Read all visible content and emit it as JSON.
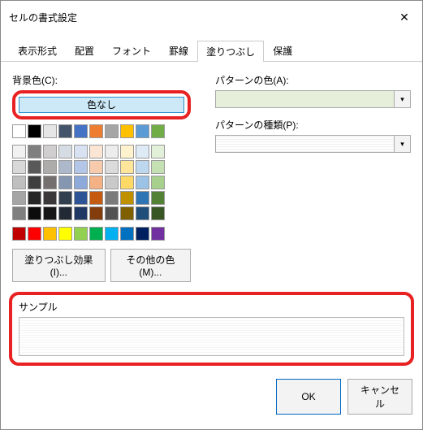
{
  "window": {
    "title": "セルの書式設定"
  },
  "tabs": [
    "表示形式",
    "配置",
    "フォント",
    "罫線",
    "塗りつぶし",
    "保護"
  ],
  "active_tab": "塗りつぶし",
  "labels": {
    "bgcolor": "背景色(C):",
    "no_color": "色なし",
    "pattern_color": "パターンの色(A):",
    "pattern_type": "パターンの種類(P):",
    "fill_effects": "塗りつぶし効果(I)...",
    "more_colors": "その他の色(M)...",
    "sample": "サンプル",
    "ok": "OK",
    "cancel": "キャンセル"
  },
  "swatches_row1": [
    "#ffffff",
    "#000000",
    "#e7e6e6",
    "#44546a",
    "#4472c4",
    "#ed7d31",
    "#a5a5a5",
    "#ffc000",
    "#5b9bd5",
    "#70ad47"
  ],
  "swatches_theme": [
    "#f2f2f2",
    "#7f7f7f",
    "#d0cece",
    "#d6dce4",
    "#d9e2f3",
    "#fbe5d5",
    "#ededed",
    "#fff2cc",
    "#deebf6",
    "#e2efd9",
    "#d8d8d8",
    "#595959",
    "#aeabab",
    "#adb9ca",
    "#b4c6e7",
    "#f7cbac",
    "#dbdbdb",
    "#fee599",
    "#bdd7ee",
    "#c5e0b3",
    "#bfbfbf",
    "#3f3f3f",
    "#757070",
    "#8496b0",
    "#8eaadb",
    "#f4b183",
    "#c9c9c9",
    "#ffd965",
    "#9cc3e5",
    "#a8d08d",
    "#a5a5a5",
    "#262626",
    "#3a3838",
    "#323f4f",
    "#2f5496",
    "#c55a11",
    "#7b7b7b",
    "#bf9000",
    "#2e75b5",
    "#538135",
    "#7f7f7f",
    "#0c0c0c",
    "#171616",
    "#222a35",
    "#1f3864",
    "#833c0b",
    "#525252",
    "#7f6000",
    "#1e4e79",
    "#375623"
  ],
  "swatches_standard": [
    "#c00000",
    "#ff0000",
    "#ffc000",
    "#ffff00",
    "#92d050",
    "#00b050",
    "#00b0f0",
    "#0070c0",
    "#002060",
    "#7030a0"
  ]
}
